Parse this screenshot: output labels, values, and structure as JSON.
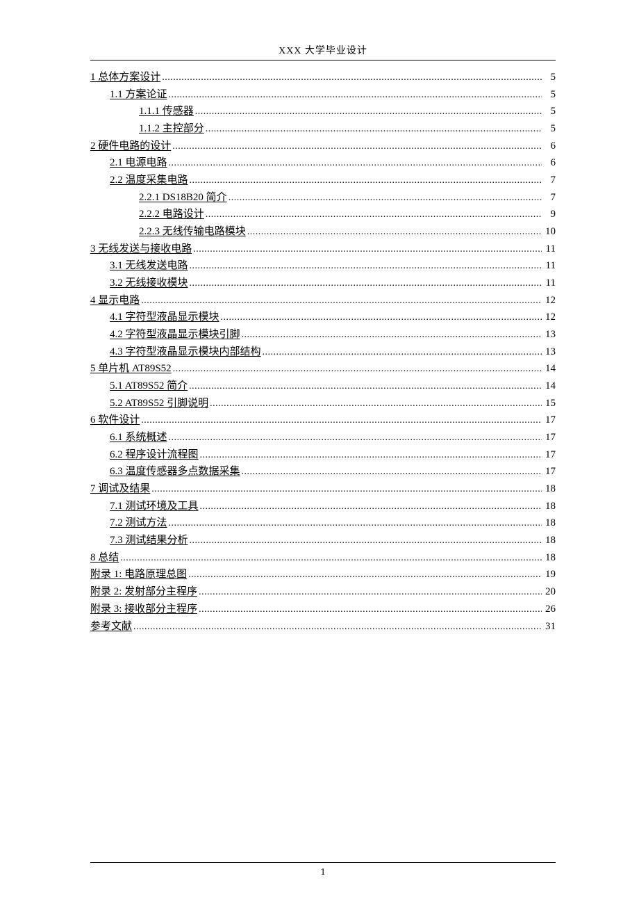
{
  "header": "XXX 大学毕业设计",
  "page_number": "1",
  "toc": [
    {
      "indent": 0,
      "label": "1 总体方案设计",
      "page": "5"
    },
    {
      "indent": 1,
      "label": "1.1   方案论证",
      "page": "5"
    },
    {
      "indent": 2,
      "label": "1.1.1   传感器",
      "page": "5"
    },
    {
      "indent": 2,
      "label": "1.1.2   主控部分",
      "page": "5"
    },
    {
      "indent": 0,
      "label": "2 硬件电路的设计",
      "page": "6"
    },
    {
      "indent": 1,
      "label": "2.1   电源电路",
      "page": "6"
    },
    {
      "indent": 1,
      "label": "2.2   温度采集电路",
      "page": "7"
    },
    {
      "indent": 2,
      "label": "2.2.1 DS18B20 简介",
      "page": "7"
    },
    {
      "indent": 2,
      "label": "2.2.2   电路设计",
      "page": "9"
    },
    {
      "indent": 2,
      "label": "2.2.3   无线传输电路模块",
      "page": "10"
    },
    {
      "indent": 0,
      "label": "3 无线发送与接收电路",
      "page": "11"
    },
    {
      "indent": 1,
      "label": "3.1   无线发送电路",
      "page": "11"
    },
    {
      "indent": 1,
      "label": "3.2   无线接收模块",
      "page": "11"
    },
    {
      "indent": 0,
      "label": "4 显示电路",
      "page": "12"
    },
    {
      "indent": 1,
      "label": "4.1   字符型液晶显示模块",
      "page": "12"
    },
    {
      "indent": 1,
      "label": "4.2   字符型液晶显示模块引脚",
      "page": "13"
    },
    {
      "indent": 1,
      "label": "4.3   字符型液晶显示模块内部结构",
      "page": "13"
    },
    {
      "indent": 0,
      "label": "5 单片机 AT89S52",
      "page": "14"
    },
    {
      "indent": 1,
      "label": "5.1   AT89S52 简介",
      "page": "14"
    },
    {
      "indent": 1,
      "label": "5.2   AT89S52 引脚说明",
      "page": "15"
    },
    {
      "indent": 0,
      "label": "6 软件设计",
      "page": "17"
    },
    {
      "indent": 1,
      "label": "6.1   系统概述",
      "page": "17"
    },
    {
      "indent": 1,
      "label": "6.2   程序设计流程图",
      "page": "17"
    },
    {
      "indent": 1,
      "label": "6.3    温度传感器多点数据采集",
      "page": "17"
    },
    {
      "indent": 0,
      "label": "7 调试及结果",
      "page": "18"
    },
    {
      "indent": 1,
      "label": "7.1   测试环境及工具",
      "page": "18"
    },
    {
      "indent": 1,
      "label": "7.2   测试方法",
      "page": "18"
    },
    {
      "indent": 1,
      "label": "7.3   测试结果分析",
      "page": "18"
    },
    {
      "indent": 0,
      "label": "8 总结",
      "page": "18"
    },
    {
      "indent": 0,
      "label": "附录 1:    电路原理总图",
      "page": "19"
    },
    {
      "indent": 0,
      "label": "附录 2:    发射部分主程序",
      "page": "20"
    },
    {
      "indent": 0,
      "label": "附录 3:    接收部分主程序",
      "page": "26"
    },
    {
      "indent": 0,
      "label": "参考文献",
      "page": "31"
    }
  ]
}
